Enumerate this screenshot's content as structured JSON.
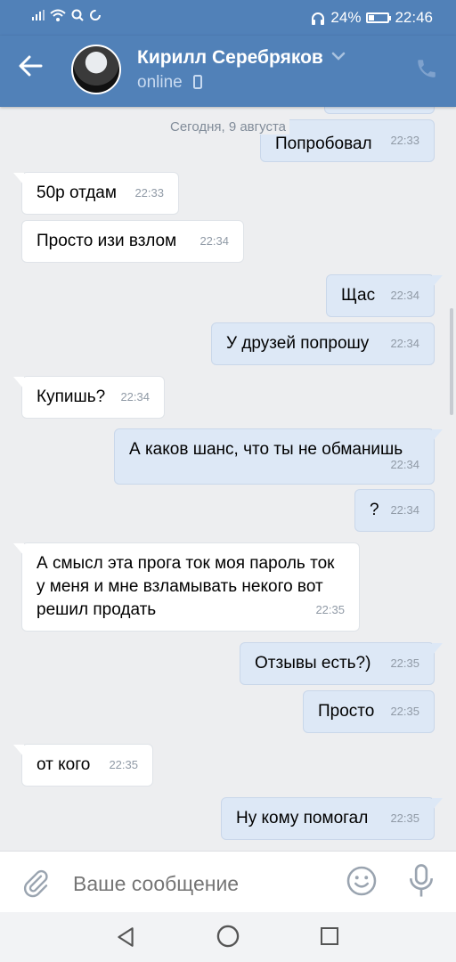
{
  "statusbar": {
    "battery": "24%",
    "time": "22:46",
    "battery_level": 0.24
  },
  "header": {
    "name": "Кирилл Серебряков",
    "status": "online"
  },
  "chat": {
    "date": "Сегодня, 9 августа",
    "messages": [
      {
        "dir": "out",
        "text": "Попробовал",
        "time": "22:33"
      },
      {
        "dir": "in",
        "text": "50р отдам",
        "time": "22:33"
      },
      {
        "dir": "in",
        "text": "Просто изи взлом",
        "time": "22:34"
      },
      {
        "dir": "out",
        "text": "Щас",
        "time": "22:34"
      },
      {
        "dir": "out",
        "text": "У друзей попрошу",
        "time": "22:34"
      },
      {
        "dir": "in",
        "text": "Купишь?",
        "time": "22:34"
      },
      {
        "dir": "out",
        "text": "А каков шанс, что ты не обманишь",
        "time": "22:34"
      },
      {
        "dir": "out",
        "text": "?",
        "time": "22:34"
      },
      {
        "dir": "in",
        "text": "А смысл эта прога ток моя пароль ток у меня и мне взламывать некого вот решил продать",
        "time": "22:35"
      },
      {
        "dir": "out",
        "text": "Отзывы есть?)",
        "time": "22:35"
      },
      {
        "dir": "out",
        "text": "Просто",
        "time": "22:35"
      },
      {
        "dir": "in",
        "text": "от кого",
        "time": "22:35"
      },
      {
        "dir": "out",
        "text": "Ну кому помогал",
        "time": "22:35"
      }
    ]
  },
  "composer": {
    "placeholder": "Ваше сообщение"
  },
  "icons": {
    "back": "arrow-left-icon",
    "call": "phone-icon",
    "attach": "paperclip-icon",
    "emoji": "smiley-icon",
    "mic": "microphone-icon"
  },
  "colors": {
    "header": "#5181b8",
    "incoming_bubble": "#ffffff",
    "outgoing_bubble": "#dde8f6",
    "background": "#edeef0"
  }
}
